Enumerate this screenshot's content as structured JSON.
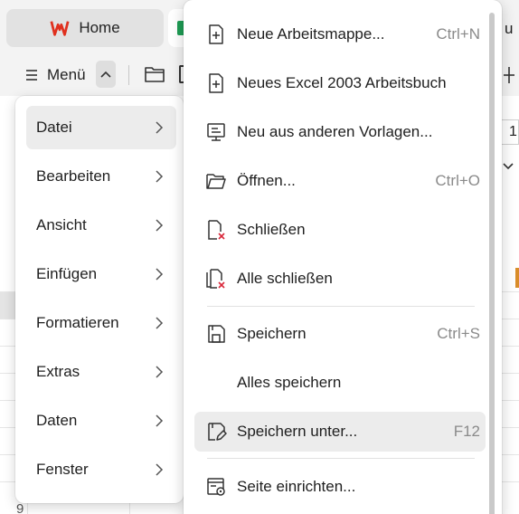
{
  "tabs": {
    "home_label": "Home"
  },
  "toolbar": {
    "menu_label": "Menü"
  },
  "left_menu": {
    "items": [
      {
        "label": "Datei"
      },
      {
        "label": "Bearbeiten"
      },
      {
        "label": "Ansicht"
      },
      {
        "label": "Einfügen"
      },
      {
        "label": "Formatieren"
      },
      {
        "label": "Extras"
      },
      {
        "label": "Daten"
      },
      {
        "label": "Fenster"
      }
    ]
  },
  "file_menu": {
    "items": [
      {
        "label": "Neue Arbeitsmappe...",
        "shortcut": "Ctrl+N",
        "icon": "new-document-icon"
      },
      {
        "label": "Neues Excel 2003 Arbeitsbuch",
        "shortcut": "",
        "icon": "new-document-icon"
      },
      {
        "label": "Neu aus anderen Vorlagen...",
        "shortcut": "",
        "icon": "template-icon"
      },
      {
        "label": "Öffnen...",
        "shortcut": "Ctrl+O",
        "icon": "folder-open-icon"
      },
      {
        "label": "Schließen",
        "shortcut": "",
        "icon": "close-document-icon"
      },
      {
        "label": "Alle schließen",
        "shortcut": "",
        "icon": "close-all-icon"
      },
      {
        "label": "Speichern",
        "shortcut": "Ctrl+S",
        "icon": "save-icon"
      },
      {
        "label": "Alles speichern",
        "shortcut": "",
        "icon": ""
      },
      {
        "label": "Speichern unter...",
        "shortcut": "F12",
        "icon": "save-as-icon"
      },
      {
        "label": "Seite einrichten...",
        "shortcut": "",
        "icon": "page-setup-icon"
      }
    ]
  },
  "sheet": {
    "partial_text_top": "u",
    "partial_text_mid": "1",
    "partial_row_label": "9"
  },
  "colors": {
    "accent_brand": "#e0301e",
    "sheet_tab_green": "#1f9d55",
    "close_mark_red": "#d9283a"
  }
}
